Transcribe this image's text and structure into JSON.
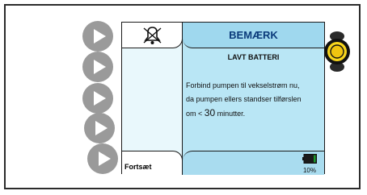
{
  "screen": {
    "title": "BEMÆRK",
    "subtitle": "LAVT BATTERI",
    "message_line1": "Forbind pumpen til vekselstrøm nu,",
    "message_line2": "da pumpen ellers standser tilførslen",
    "message_prefix": "om <",
    "message_number": "30",
    "message_suffix": "minutter.",
    "left_button_label": "Fortsæt",
    "battery_level_text": "10%",
    "battery_level": 0.1
  },
  "icons": {
    "alarm": "muted-bell-icon",
    "side_buttons": "play-triangle-icon",
    "led": "yellow-led-indicator-icon",
    "battery": "battery-icon"
  },
  "colors": {
    "screen_bg": "#b9e6f5",
    "title_text": "#0a3a7a",
    "led_yellow": "#f7d51d",
    "battery_green": "#1a9a2a",
    "side_button_grey": "#9a9a9a"
  }
}
